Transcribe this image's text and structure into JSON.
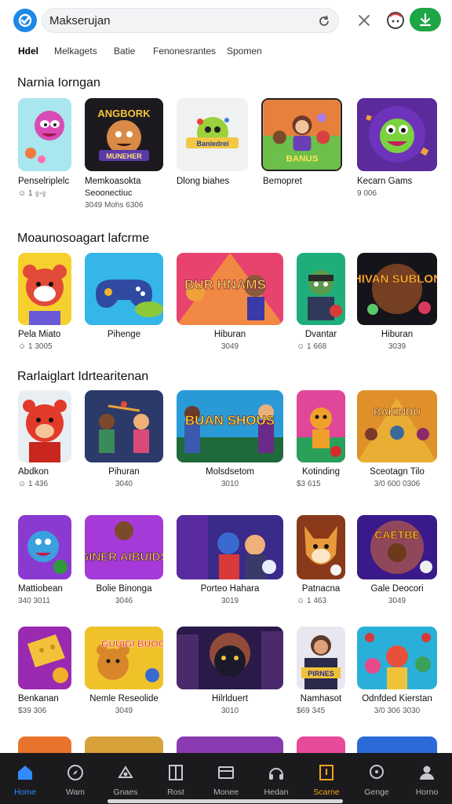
{
  "header": {
    "search_value": "Makserujan",
    "colors": {
      "logo": "#1e88e5",
      "accent_green": "#1ea545",
      "nav_bg": "#1b1b1e",
      "nav_active": "#2f8bff",
      "nav_gold": "#f2a21c"
    }
  },
  "tabs": [
    {
      "label": "Hdel"
    },
    {
      "label": "Melkagets"
    },
    {
      "label": "Batie"
    },
    {
      "label": "Fenonesrantes"
    },
    {
      "label": "Spomen"
    }
  ],
  "sections": [
    {
      "title": "Narnia Iorngan",
      "cards": [
        {
          "name": "Penselriplelc",
          "meta": "☺ 1 ඉංඉ"
        },
        {
          "name": "Memkoasokta",
          "meta": "Seoonectiuc",
          "meta2": "3049  Mohs  6306"
        },
        {
          "name": "Dlong biahes",
          "meta": ""
        },
        {
          "name": "Bemopret",
          "meta": ""
        },
        {
          "name": "Kecarn Gams",
          "meta": "9 006"
        }
      ]
    },
    {
      "title": "Moaunosoagart lafcrme",
      "cards": [
        {
          "name": "Pela Miato",
          "meta": "☺ 1 3005"
        },
        {
          "name": "Pihenge",
          "meta": ""
        },
        {
          "name": "Hiburan",
          "meta": "3049"
        },
        {
          "name": "Dvantar",
          "meta": "☺ 1 668"
        },
        {
          "name": "Hiburan",
          "meta": "3039"
        }
      ]
    },
    {
      "title": "Rarlaiglart Idrtearitenan",
      "cards": [
        {
          "name": "Abdkon",
          "meta": "☺ 1 436"
        },
        {
          "name": "Pihuran",
          "meta": "3040"
        },
        {
          "name": "Molsdsetom",
          "meta": "3010"
        },
        {
          "name": "Kotinding",
          "meta": "$3 615"
        },
        {
          "name": "Sceotagn Tilo",
          "meta": "3/0  600  0306"
        }
      ]
    },
    {
      "title": "",
      "cards": [
        {
          "name": "Mattiobean",
          "meta": "340  3011"
        },
        {
          "name": "Bolie Binonga",
          "meta": "3046"
        },
        {
          "name": "Porteo Hahara",
          "meta": "3019"
        },
        {
          "name": "Patnacna",
          "meta": "☺ 1 463"
        },
        {
          "name": "Gale Deocori",
          "meta": "3049"
        }
      ]
    },
    {
      "title": "",
      "cards": [
        {
          "name": "Benkanan",
          "meta": "$39  306"
        },
        {
          "name": "Nemle Reseolide",
          "meta": "3049"
        },
        {
          "name": "Hilrlduert",
          "meta": "3010"
        },
        {
          "name": "Namhasot",
          "meta": "$69  345"
        },
        {
          "name": "Odnfded Kierstan",
          "meta": "3/0  306  3030"
        }
      ]
    }
  ],
  "thumb_texts": {
    "s1c2": "ANGBORK",
    "s1c2b": "MUNEHER",
    "s1c3": "Baniedrei",
    "s1c4": "BANUS",
    "s2c3": "BUR HNAMS",
    "s2c5": "CHIVAN SUBLONS",
    "s3c3": "BUAN SHOUS",
    "s3c5": "BAKINDU",
    "s4c2": "GINER AIBUIDS",
    "s4c5": "CAETBE",
    "s5c2": "GUUIGI BUOOS",
    "s5c4": "PIRNES"
  },
  "bottom_nav": [
    {
      "label": "Home"
    },
    {
      "label": "Wam"
    },
    {
      "label": "Gnaes"
    },
    {
      "label": "Rost"
    },
    {
      "label": "Monee"
    },
    {
      "label": "Hedan"
    },
    {
      "label": "Scarne"
    },
    {
      "label": "Genge"
    },
    {
      "label": "Horno"
    }
  ]
}
